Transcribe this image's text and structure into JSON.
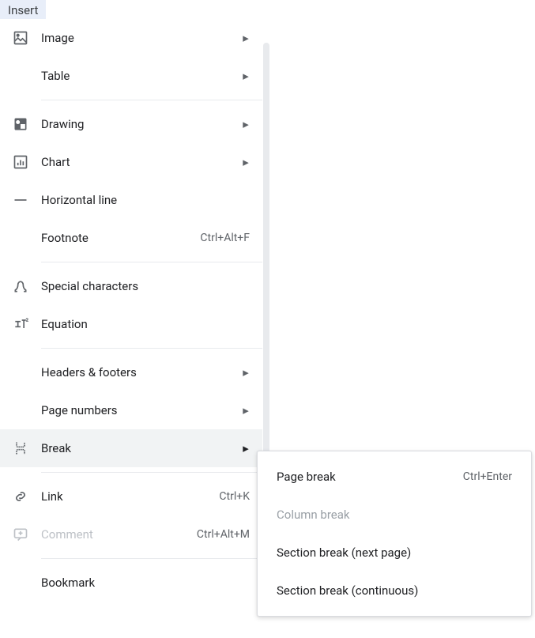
{
  "menuButton": "Insert",
  "items": {
    "image": {
      "label": "Image"
    },
    "table": {
      "label": "Table"
    },
    "drawing": {
      "label": "Drawing"
    },
    "chart": {
      "label": "Chart"
    },
    "horizontalLine": {
      "label": "Horizontal line"
    },
    "footnote": {
      "label": "Footnote",
      "shortcut": "Ctrl+Alt+F"
    },
    "specialCharacters": {
      "label": "Special characters"
    },
    "equation": {
      "label": "Equation"
    },
    "headersFooters": {
      "label": "Headers & footers"
    },
    "pageNumbers": {
      "label": "Page numbers"
    },
    "break": {
      "label": "Break"
    },
    "link": {
      "label": "Link",
      "shortcut": "Ctrl+K"
    },
    "comment": {
      "label": "Comment",
      "shortcut": "Ctrl+Alt+M"
    },
    "bookmark": {
      "label": "Bookmark"
    }
  },
  "submenu": {
    "pageBreak": {
      "label": "Page break",
      "shortcut": "Ctrl+Enter"
    },
    "columnBreak": {
      "label": "Column break"
    },
    "sectionBreakNext": {
      "label": "Section break (next page)"
    },
    "sectionBreakCont": {
      "label": "Section break (continuous)"
    }
  }
}
